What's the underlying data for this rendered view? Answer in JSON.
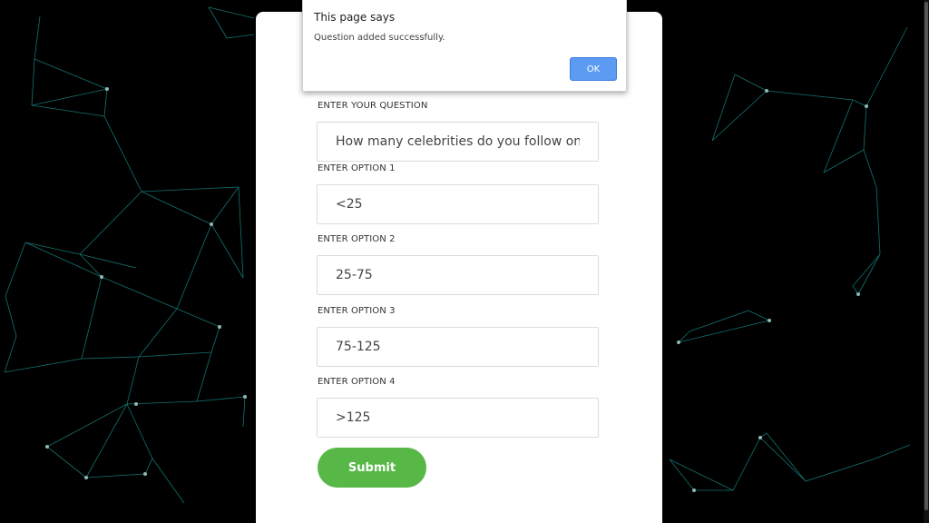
{
  "form": {
    "question_label": "ENTER YOUR QUESTION",
    "question_value": "How many celebrities do you follow on s",
    "options": [
      {
        "label": "ENTER OPTION 1",
        "value": "<25"
      },
      {
        "label": "ENTER OPTION 2",
        "value": "25-75"
      },
      {
        "label": "ENTER OPTION 3",
        "value": "75-125"
      },
      {
        "label": "ENTER OPTION 4",
        "value": ">125"
      }
    ],
    "submit_label": "Submit"
  },
  "dialog": {
    "title": "This page says",
    "message": "Question added successfully.",
    "ok_label": "OK"
  },
  "colors": {
    "accent_submit": "#57b847",
    "ok_button": "#5b9bf2",
    "network_lines": "#1a8f8f",
    "background": "#000000"
  }
}
